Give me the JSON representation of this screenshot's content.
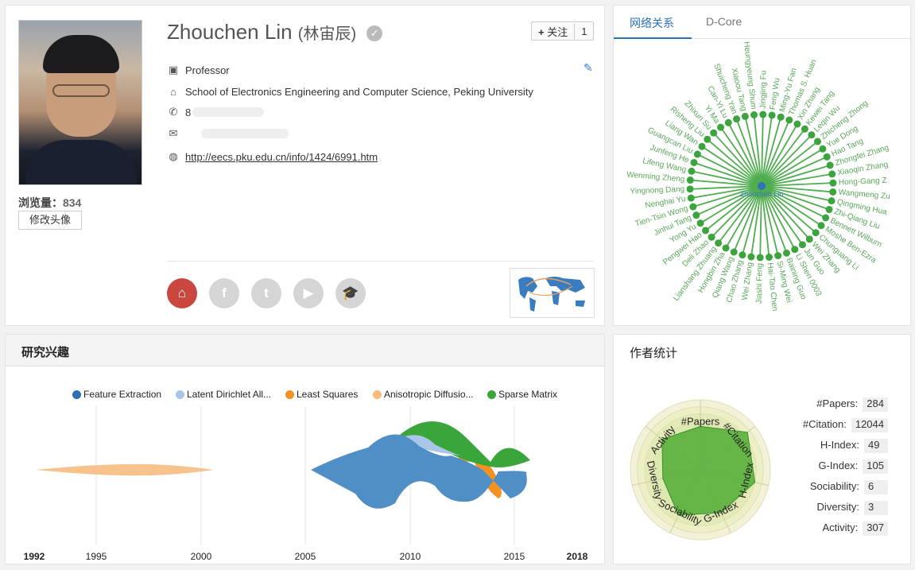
{
  "profile": {
    "name": "Zhouchen Lin",
    "name_cn": "(林宙辰)",
    "follow_label": "关注",
    "follow_count": "1",
    "position": "Professor",
    "affiliation": "School of Electronics Engineering and Computer Science, Peking University",
    "phone_prefix": "8",
    "homepage": "http://eecs.pku.edu.cn/info/1424/6991.htm",
    "views_label": "浏览量：",
    "views": "834",
    "edit_avatar_label": "修改头像"
  },
  "network": {
    "tabs": [
      "网络关系",
      "D-Core"
    ],
    "center": "Zhouchen Lin",
    "coauthors": [
      "Jingjing Fu",
      "Feng Wu",
      "Ming-Yu Fan",
      "Thomas S. Huan",
      "Xin Zhang",
      "Kewei Tang",
      "Leqin Wu",
      "Zhicheng Zhong",
      "Yue Dong",
      "Hao Tang",
      "Zhongfei Zhang",
      "Xiaoqin Zhang",
      "Hong-Gang Z",
      "Wangmeng Zu",
      "Qingming Hua",
      "Zhi-Qiang Liu",
      "Bennett Wilburn",
      "Moshe Ben-Ezra",
      "Chunguang Li",
      "Wei Zhang",
      "Jun Guo",
      "Li Shen 0003",
      "Baining Guo",
      "Si-Ming Wei",
      "Hai-Tao Chen",
      "Jiashi Feng",
      "Wei Zhang",
      "Chao Zhang",
      "Qiang Wang",
      "Hongbin Zha",
      "Lianshang Zhuang",
      "Deli Zhao",
      "Pengwei Hao",
      "Yong Yu",
      "Jinhui Tang",
      "Tien-Tsin Wong",
      "Nenghai Yu",
      "Yingnong Dang",
      "Wenming Zheng",
      "Lifeng Wang",
      "Junfeng He",
      "Guangcan Liu",
      "Liang Wan",
      "Risheng Liu",
      "Zhixun Su",
      "Yi Ma",
      "Can-Yi Lu",
      "Shuicheng Yan",
      "Xiaoou Tang",
      "Heungyeung Shum"
    ]
  },
  "interests": {
    "title": "研究兴趣",
    "legend": [
      {
        "name": "Feature Extraction",
        "color": "#2e6fae"
      },
      {
        "name": "Latent Dirichlet All...",
        "color": "#a9c6e8"
      },
      {
        "name": "Least Squares",
        "color": "#f39223"
      },
      {
        "name": "Anisotropic Diffusio...",
        "color": "#f8bb7e"
      },
      {
        "name": "Sparse Matrix",
        "color": "#3aa53a"
      }
    ],
    "axis_labels": [
      "1992",
      "1995",
      "2000",
      "2005",
      "2010",
      "2015",
      "2018"
    ]
  },
  "stats": {
    "title": "作者统计",
    "radar_labels": [
      "#Papers",
      "#Citation",
      "H-Index",
      "G-Index",
      "Sociability",
      "Diversity",
      "Activity"
    ],
    "rows": [
      {
        "label": "#Papers:",
        "value": "284"
      },
      {
        "label": "#Citation:",
        "value": "12044"
      },
      {
        "label": "H-Index:",
        "value": "49"
      },
      {
        "label": "G-Index:",
        "value": "105"
      },
      {
        "label": "Sociability:",
        "value": "6"
      },
      {
        "label": "Diversity:",
        "value": "3"
      },
      {
        "label": "Activity:",
        "value": "307"
      }
    ]
  }
}
